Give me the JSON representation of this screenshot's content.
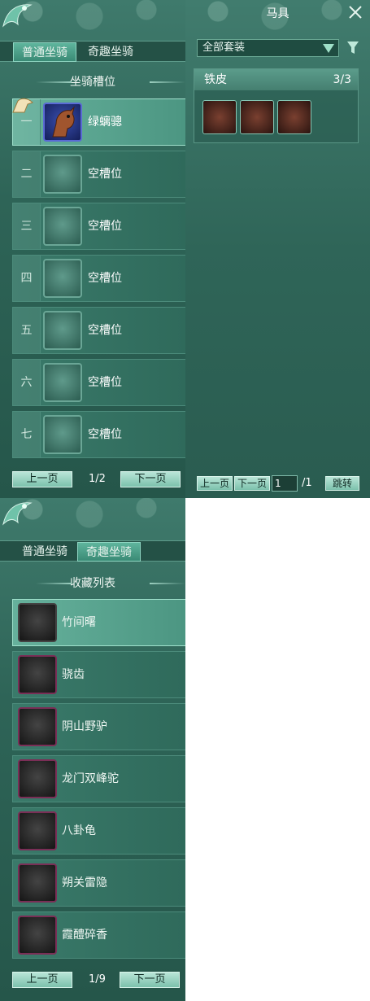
{
  "mount_panel": {
    "tabs": [
      {
        "label": "普通坐骑"
      },
      {
        "label": "奇趣坐骑"
      }
    ],
    "section_title": "坐骑槽位",
    "slots": [
      {
        "num": "一",
        "label": "绿螭骢"
      },
      {
        "num": "二",
        "label": "空槽位"
      },
      {
        "num": "三",
        "label": "空槽位"
      },
      {
        "num": "四",
        "label": "空槽位"
      },
      {
        "num": "五",
        "label": "空槽位"
      },
      {
        "num": "六",
        "label": "空槽位"
      },
      {
        "num": "七",
        "label": "空槽位"
      }
    ],
    "prev_label": "上一页",
    "next_label": "下一页",
    "page": "1/2"
  },
  "gear_panel": {
    "title": "马具",
    "filter_value": "全部套装",
    "set": {
      "name": "铁皮",
      "count": "3/3"
    },
    "prev_label": "上一页",
    "next_label": "下一页",
    "page_input": "1",
    "total_pages": "/1",
    "jump_label": "跳转"
  },
  "collection_panel": {
    "tabs": [
      {
        "label": "普通坐骑"
      },
      {
        "label": "奇趣坐骑"
      }
    ],
    "section_title": "收藏列表",
    "items": [
      {
        "label": "竹间曙"
      },
      {
        "label": "骁齿"
      },
      {
        "label": "阴山野驴"
      },
      {
        "label": "龙门双峰驼"
      },
      {
        "label": "八卦龟"
      },
      {
        "label": "朔关雷隐"
      },
      {
        "label": "霞醴碎香"
      }
    ],
    "prev_label": "上一页",
    "next_label": "下一页",
    "page": "1/9"
  },
  "colors": {
    "accent": "#4c9682",
    "panel_bg": "#2e6457",
    "button": "#9fd6c5"
  }
}
